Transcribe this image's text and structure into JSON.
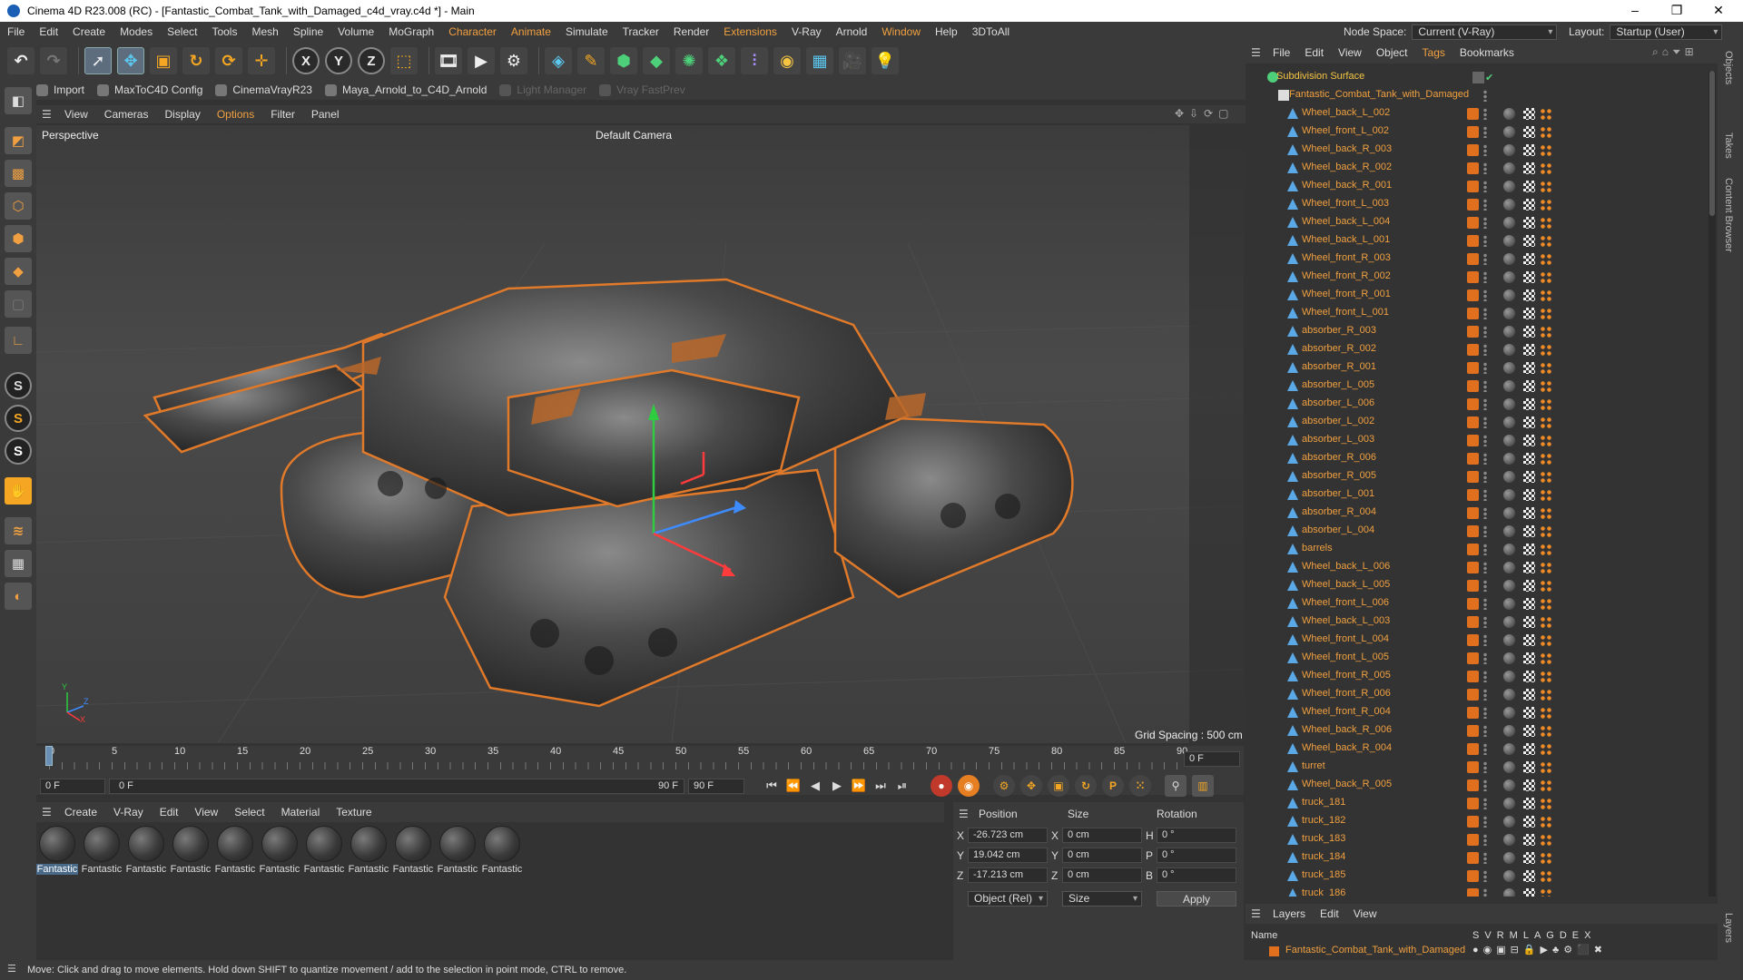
{
  "window": {
    "title": "Cinema 4D R23.008 (RC) - [Fantastic_Combat_Tank_with_Damaged_c4d_vray.c4d *] - Main",
    "controls": [
      "–",
      "❐",
      "✕"
    ]
  },
  "menubar": {
    "items": [
      "File",
      "Edit",
      "Create",
      "Modes",
      "Select",
      "Tools",
      "Mesh",
      "Spline",
      "Volume",
      "MoGraph",
      "Character",
      "Animate",
      "Simulate",
      "Tracker",
      "Render",
      "Extensions",
      "V-Ray",
      "Arnold",
      "Window",
      "Help",
      "3DToAll"
    ],
    "highlighted": [
      "Character",
      "Animate",
      "Extensions",
      "Window"
    ],
    "node_space_label": "Node Space:",
    "node_space_value": "Current (V-Ray)",
    "layout_label": "Layout:",
    "layout_value": "Startup (User)"
  },
  "pluginbar": {
    "items": [
      {
        "label": "Import",
        "disabled": false
      },
      {
        "label": "MaxToC4D Config",
        "disabled": false
      },
      {
        "label": "CinemaVrayR23",
        "disabled": false
      },
      {
        "label": "Maya_Arnold_to_C4D_Arnold",
        "disabled": false
      },
      {
        "label": "Light Manager",
        "disabled": true
      },
      {
        "label": "Vray FastPrev",
        "disabled": true
      }
    ]
  },
  "viewport": {
    "menu": [
      "View",
      "Cameras",
      "Display",
      "Options",
      "Filter",
      "Panel"
    ],
    "highlighted": "Options",
    "label": "Perspective",
    "camera": "Default Camera",
    "grid_spacing": "Grid Spacing : 500 cm",
    "axis_y": "Y",
    "axis_z": "Z",
    "axis_x": "X"
  },
  "timeline": {
    "ticks": [
      "0",
      "5",
      "10",
      "15",
      "20",
      "25",
      "30",
      "35",
      "40",
      "45",
      "50",
      "55",
      "60",
      "65",
      "70",
      "75",
      "80",
      "85",
      "90"
    ],
    "current_frame": "0 F",
    "start_field": "0 F",
    "range_start": "0 F",
    "range_end": "90 F",
    "end_field": "90 F"
  },
  "materials": {
    "menu": [
      "Create",
      "V-Ray",
      "Edit",
      "View",
      "Select",
      "Material",
      "Texture"
    ],
    "items": [
      "Fantastic",
      "Fantastic",
      "Fantastic",
      "Fantastic",
      "Fantastic",
      "Fantastic",
      "Fantastic",
      "Fantastic",
      "Fantastic",
      "Fantastic",
      "Fantastic"
    ]
  },
  "coordinates": {
    "headers": [
      "Position",
      "Size",
      "Rotation"
    ],
    "rows": [
      {
        "axis": "X",
        "pos": "-26.723 cm",
        "size_axis": "X",
        "size": "0 cm",
        "rot_axis": "H",
        "rot": "0 °"
      },
      {
        "axis": "Y",
        "pos": "19.042 cm",
        "size_axis": "Y",
        "size": "0 cm",
        "rot_axis": "P",
        "rot": "0 °"
      },
      {
        "axis": "Z",
        "pos": "-17.213 cm",
        "size_axis": "Z",
        "size": "0 cm",
        "rot_axis": "B",
        "rot": "0 °"
      }
    ],
    "mode": "Object (Rel)",
    "size_mode": "Size",
    "apply": "Apply"
  },
  "objects": {
    "menu": [
      "File",
      "Edit",
      "View",
      "Object",
      "Tags",
      "Bookmarks"
    ],
    "highlighted": "Tags",
    "root": "Subdivision Surface",
    "group": "Fantastic_Combat_Tank_with_Damaged",
    "items": [
      "Wheel_back_L_002",
      "Wheel_front_L_002",
      "Wheel_back_R_003",
      "Wheel_back_R_002",
      "Wheel_back_R_001",
      "Wheel_front_L_003",
      "Wheel_back_L_004",
      "Wheel_back_L_001",
      "Wheel_front_R_003",
      "Wheel_front_R_002",
      "Wheel_front_R_001",
      "Wheel_front_L_001",
      "absorber_R_003",
      "absorber_R_002",
      "absorber_R_001",
      "absorber_L_005",
      "absorber_L_006",
      "absorber_L_002",
      "absorber_L_003",
      "absorber_R_006",
      "absorber_R_005",
      "absorber_L_001",
      "absorber_R_004",
      "absorber_L_004",
      "barrels",
      "Wheel_back_L_006",
      "Wheel_back_L_005",
      "Wheel_front_L_006",
      "Wheel_back_L_003",
      "Wheel_front_L_004",
      "Wheel_front_L_005",
      "Wheel_front_R_005",
      "Wheel_front_R_006",
      "Wheel_front_R_004",
      "Wheel_back_R_006",
      "Wheel_back_R_004",
      "turret",
      "Wheel_back_R_005",
      "truck_181",
      "truck_182",
      "truck_183",
      "truck_184",
      "truck_185",
      "truck_186"
    ]
  },
  "layers": {
    "menu": [
      "Layers",
      "Edit",
      "View"
    ],
    "name_header": "Name",
    "columns": [
      "S",
      "V",
      "R",
      "M",
      "L",
      "A",
      "G",
      "D",
      "E",
      "X"
    ],
    "row": "Fantastic_Combat_Tank_with_Damaged"
  },
  "sidetabs": [
    "Objects",
    "Takes",
    "Content Browser",
    "Layers"
  ],
  "status": "Move: Click and drag to move elements. Hold down SHIFT to quantize movement / add to the selection in point mode, CTRL to remove.",
  "colors": {
    "accent": "#f0a040",
    "object_name": "#f0a040",
    "tag_orange": "#e0701e",
    "panel_bg": "#3a3a3a",
    "viewport_bg": "#444444"
  }
}
